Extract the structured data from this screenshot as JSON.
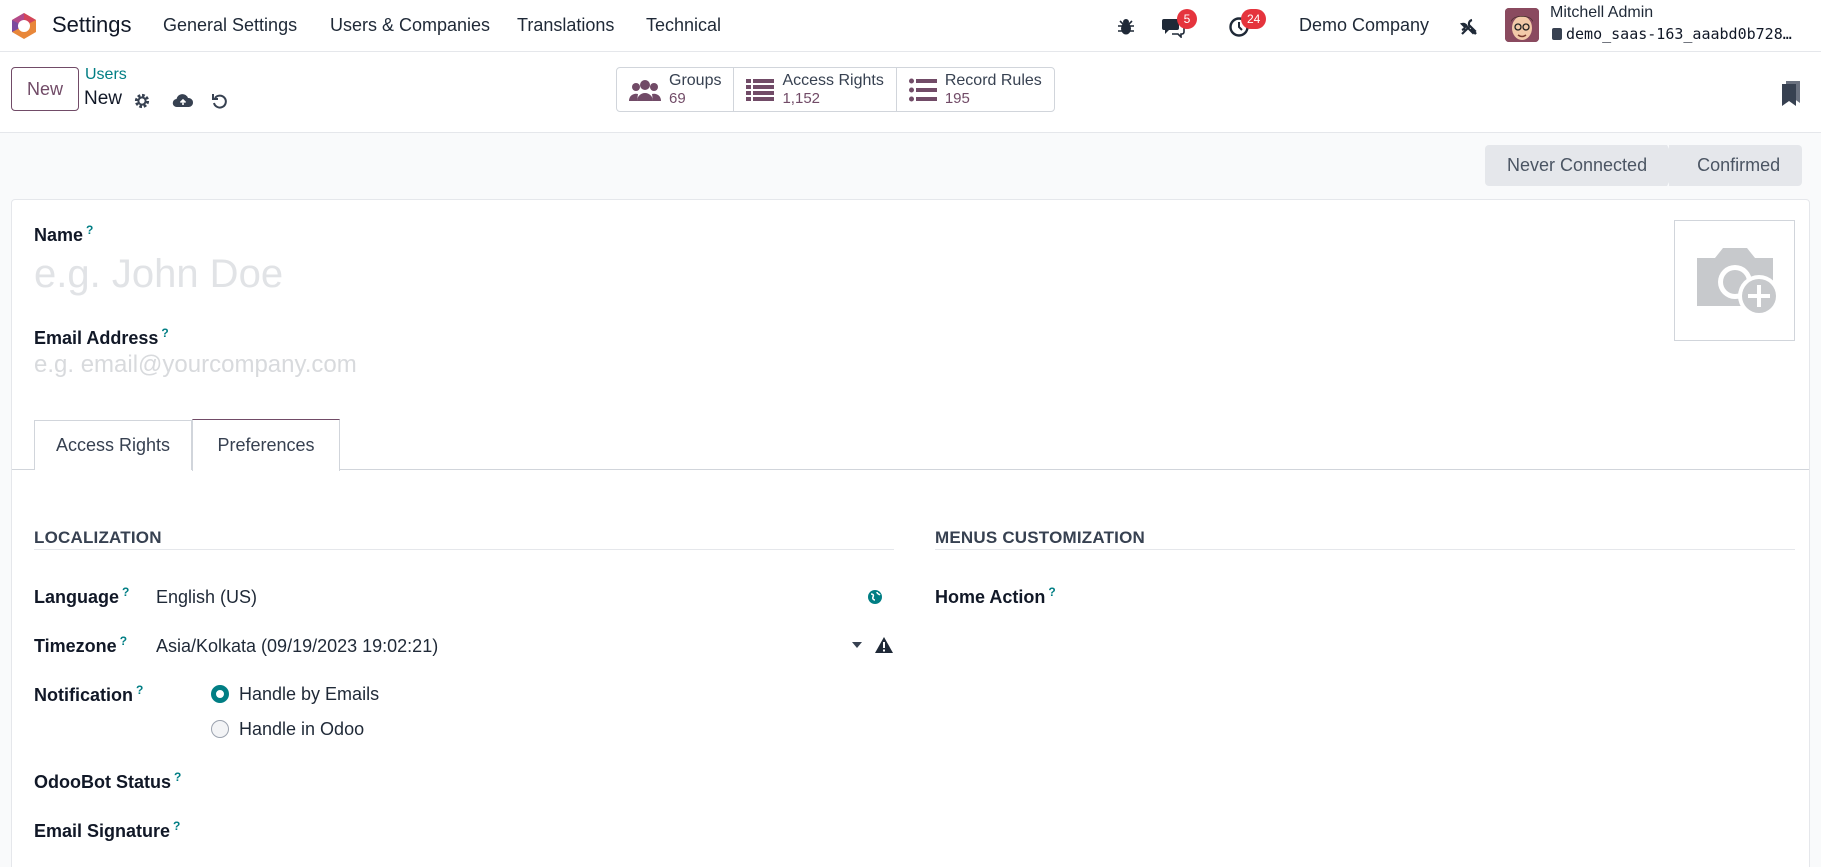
{
  "navbar": {
    "app_name": "Settings",
    "menu": [
      "General Settings",
      "Users & Companies",
      "Translations",
      "Technical"
    ],
    "messages_badge": "5",
    "activities_badge": "24",
    "company": "Demo Company",
    "user_name": "Mitchell Admin",
    "database": "demo_saas-163_aaabd0b728…",
    "brand_color": "#714b67",
    "accent_color": "#017e84",
    "badge_color": "#e5343d"
  },
  "control": {
    "new_label": "New",
    "breadcrumb_parent": "Users",
    "breadcrumb_current": "New",
    "stats": [
      {
        "label": "Groups",
        "value": "69",
        "icon": "users-icon"
      },
      {
        "label": "Access Rights",
        "value": "1,152",
        "icon": "list-icon"
      },
      {
        "label": "Record Rules",
        "value": "195",
        "icon": "list-icon"
      }
    ]
  },
  "status": {
    "stages": [
      "Never Connected",
      "Confirmed"
    ]
  },
  "form": {
    "name_label": "Name",
    "name_placeholder": "e.g. John Doe",
    "email_label": "Email Address",
    "email_placeholder": "e.g. email@yourcompany.com",
    "help_mark": "?",
    "tabs": [
      "Access Rights",
      "Preferences"
    ],
    "localization_title": "LOCALIZATION",
    "menus_title": "MENUS CUSTOMIZATION",
    "language_label": "Language",
    "language_value": "English (US)",
    "timezone_label": "Timezone",
    "timezone_value": "Asia/Kolkata (09/19/2023 19:02:21)",
    "notification_label": "Notification",
    "notification_options": [
      "Handle by Emails",
      "Handle in Odoo"
    ],
    "odoobot_label": "OdooBot Status",
    "signature_label": "Email Signature",
    "home_action_label": "Home Action"
  }
}
